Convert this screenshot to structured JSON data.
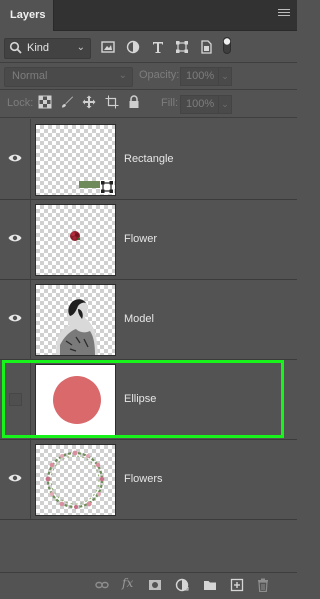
{
  "panel": {
    "tab_label": "Layers"
  },
  "filter": {
    "kind_label": "Kind"
  },
  "blend": {
    "mode": "Normal",
    "opacity_label": "Opacity:",
    "opacity_value": "100%"
  },
  "lock": {
    "label": "Lock:",
    "fill_label": "Fill:",
    "fill_value": "100%"
  },
  "layers": [
    {
      "name": "Rectangle",
      "visible": true
    },
    {
      "name": "Flower",
      "visible": true
    },
    {
      "name": "Model",
      "visible": true
    },
    {
      "name": "Ellipse",
      "visible": false
    },
    {
      "name": "Flowers",
      "visible": true
    }
  ],
  "footer": {
    "fx_label": "fx"
  },
  "colors": {
    "panel_bg": "#535353",
    "highlight": "#19f31c",
    "ellipse_fill": "#d9696b",
    "rectangle_fill": "#6e8a5a"
  },
  "icons": {
    "filter": [
      "image-filter-icon",
      "adjustment-filter-icon",
      "type-filter-icon",
      "shape-filter-icon",
      "smart-object-filter-icon",
      "filter-toggle-icon"
    ],
    "lock": [
      "lock-transparent-pixels-icon",
      "lock-image-pixels-icon",
      "lock-position-icon",
      "lock-artboard-icon",
      "lock-all-icon"
    ],
    "footer": [
      "link-layers-icon",
      "add-layer-style-icon",
      "add-mask-icon",
      "new-adjustment-layer-icon",
      "new-group-icon",
      "new-layer-icon",
      "delete-layer-icon"
    ]
  }
}
